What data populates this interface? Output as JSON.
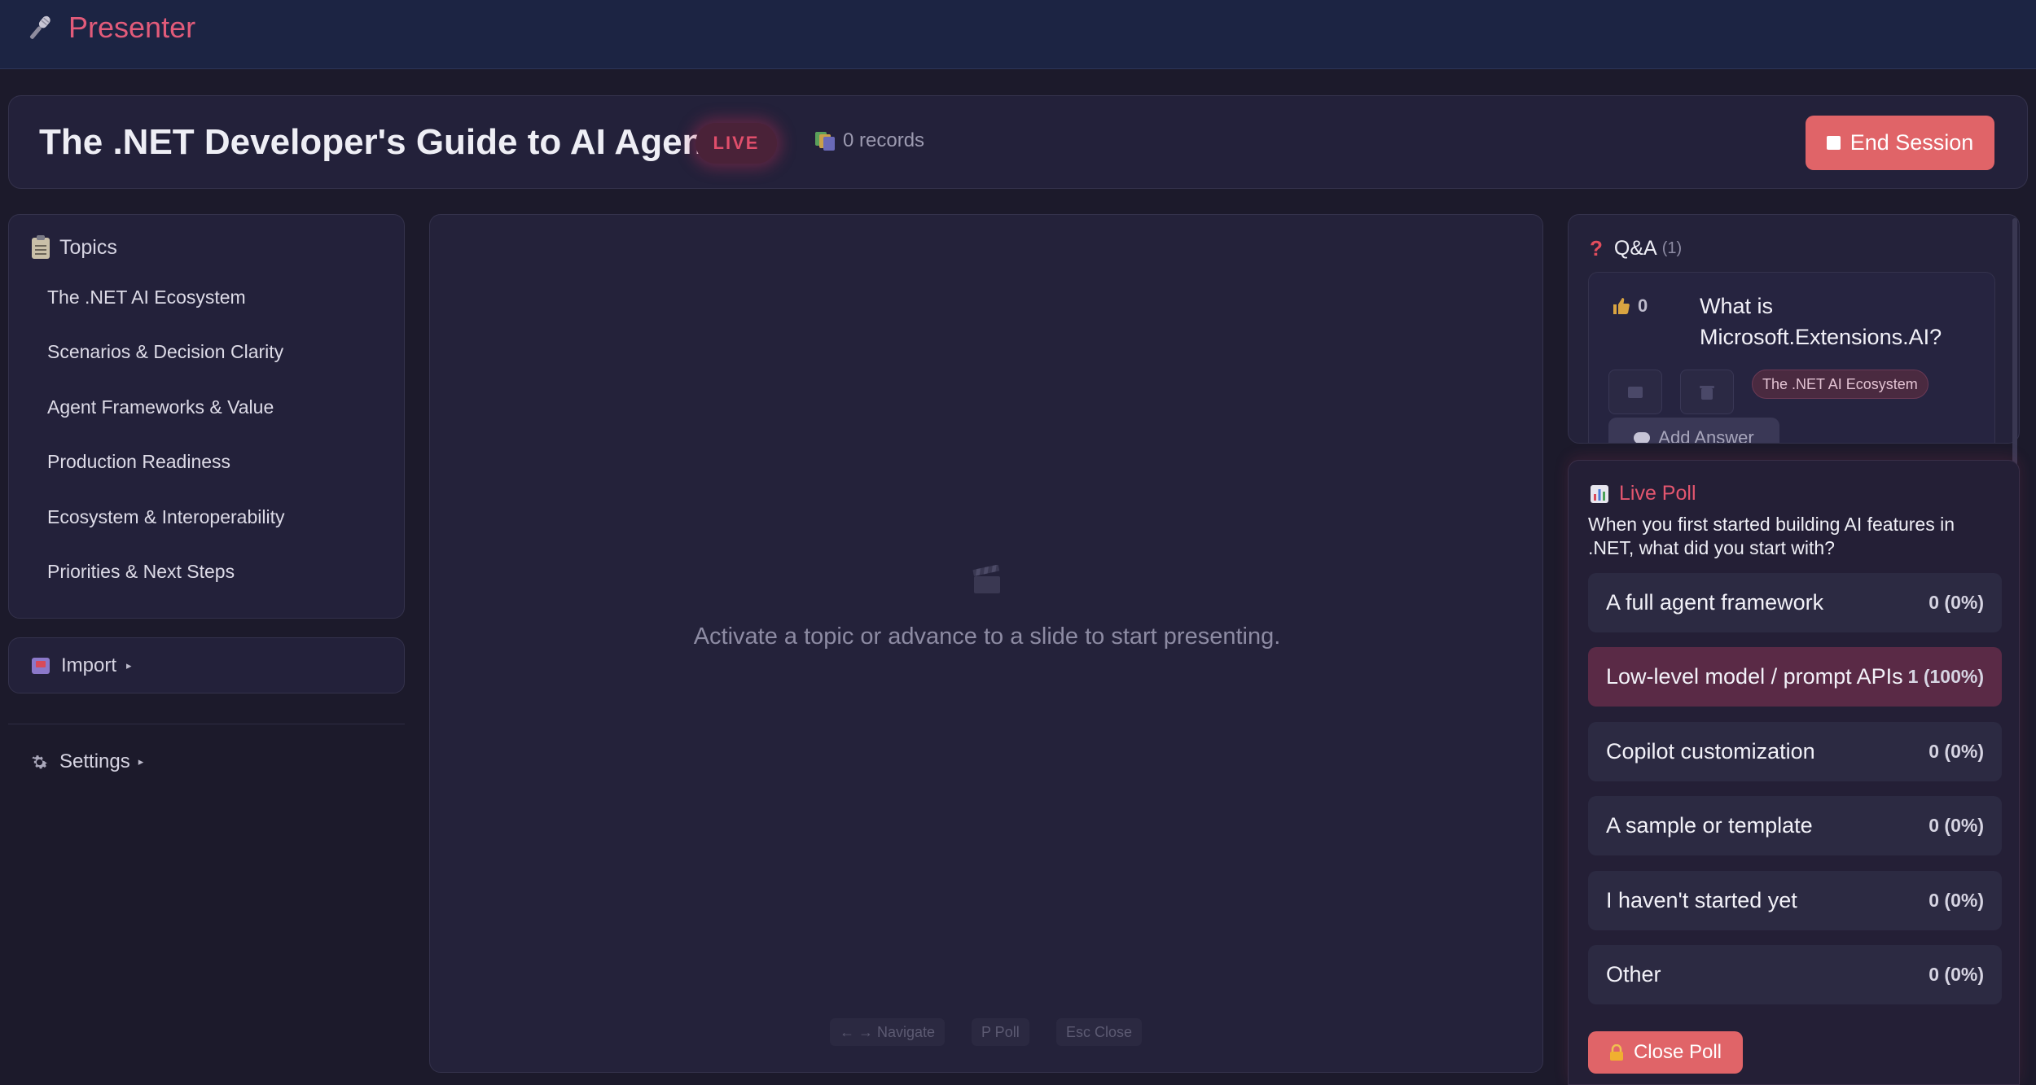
{
  "app": {
    "brand": "Presenter"
  },
  "session": {
    "title": "The .NET Developer's Guide to AI Agents",
    "status": "LIVE",
    "records": "0 records",
    "end_label": "End Session",
    "accent_color": "#e06468"
  },
  "topics": {
    "heading": "Topics",
    "items": [
      {
        "label": "The .NET AI Ecosystem"
      },
      {
        "label": "Scenarios & Decision Clarity"
      },
      {
        "label": "Agent Frameworks & Value"
      },
      {
        "label": "Production Readiness"
      },
      {
        "label": "Ecosystem & Interoperability"
      },
      {
        "label": "Priorities & Next Steps"
      }
    ]
  },
  "import": {
    "label": "Import",
    "caret": "▸"
  },
  "settings": {
    "label": "Settings",
    "caret": "▸"
  },
  "stage": {
    "message": "Activate a topic or advance to a slide to start presenting.",
    "hints": {
      "navigate": "← → Navigate",
      "poll": "P Poll",
      "close": "Esc Close"
    }
  },
  "qa": {
    "heading": "Q&A",
    "count": "(1)",
    "questions": [
      {
        "votes": "0",
        "text": "What is Microsoft.Extensions.AI?",
        "tag": "The .NET AI Ecosystem",
        "add_answer_label": "Add Answer"
      }
    ]
  },
  "poll": {
    "heading": "Live Poll",
    "question": "When you first started building AI features in .NET, what did you start with?",
    "options": [
      {
        "label": "A full agent framework",
        "result": "0 (0%)",
        "share": 0
      },
      {
        "label": "Low-level model / prompt APIs",
        "result": "1 (100%)",
        "share": 1
      },
      {
        "label": "Copilot customization",
        "result": "0 (0%)",
        "share": 0
      },
      {
        "label": "A sample or template",
        "result": "0 (0%)",
        "share": 0
      },
      {
        "label": "I haven't started yet",
        "result": "0 (0%)",
        "share": 0
      },
      {
        "label": "Other",
        "result": "0 (0%)",
        "share": 0
      }
    ],
    "close_label": "Close Poll"
  }
}
